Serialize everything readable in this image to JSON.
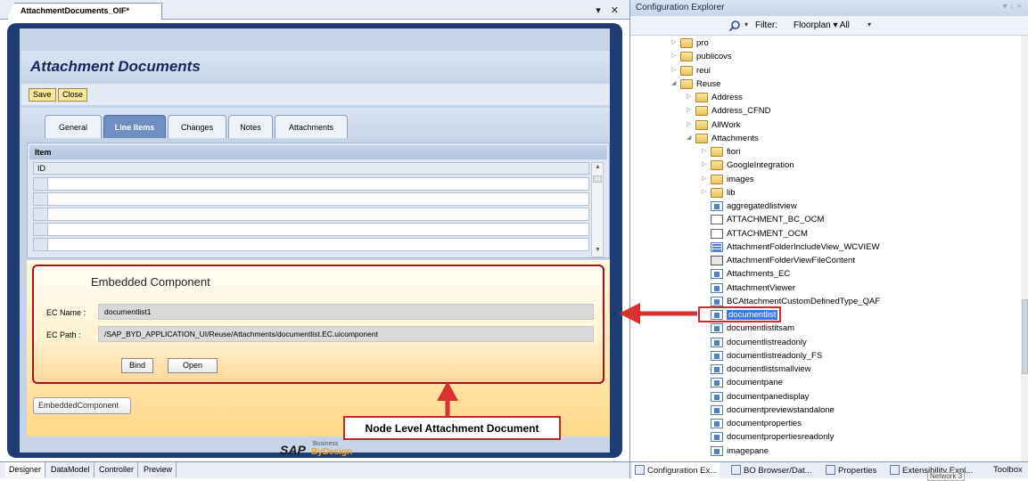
{
  "document_tab": {
    "title": "AttachmentDocuments_OIF*",
    "controls": "▾ ✕"
  },
  "page": {
    "title": "Attachment Documents"
  },
  "toolbar": {
    "save_label": "Save",
    "close_label": "Close"
  },
  "tabs": [
    {
      "label": "General"
    },
    {
      "label": "Line Items"
    },
    {
      "label": "Changes"
    },
    {
      "label": "Notes"
    },
    {
      "label": "Attachments"
    }
  ],
  "items_panel": {
    "title": "Item",
    "column": "ID"
  },
  "embedded_component": {
    "title": "Embedded Component",
    "name_label": "EC Name :",
    "name_value": "documentlist1",
    "path_label": "EC Path :",
    "path_value": "/SAP_BYD_APPLICATION_UI/Reuse/Attachments/documentlist.EC.uicomponent",
    "bind_label": "Bind",
    "open_label": "Open"
  },
  "embedded_component_button": "EmbeddedComponent",
  "callout": "Node Level Attachment Document",
  "logo": {
    "main": "SAP",
    "small": "Business",
    "product": "ByDesign"
  },
  "designer_tabs": [
    {
      "label": "Designer"
    },
    {
      "label": "DataModel"
    },
    {
      "label": "Controller"
    },
    {
      "label": "Preview"
    }
  ],
  "explorer": {
    "title": "Configuration Explorer",
    "title_controls": "▾ ↓ ×",
    "filter_label": "Filter:",
    "filter_value": "Floorplan  ▾ All",
    "tree": [
      {
        "label": "pro"
      },
      {
        "label": "publicovs"
      },
      {
        "label": "reui"
      },
      {
        "label": "Reuse"
      },
      {
        "label": "Address"
      },
      {
        "label": "Address_CFND"
      },
      {
        "label": "AllWork"
      },
      {
        "label": "Attachments"
      },
      {
        "label": "fiori"
      },
      {
        "label": "GoogleIntegration"
      },
      {
        "label": "images"
      },
      {
        "label": "lib"
      },
      {
        "label": "aggregatedlistview"
      },
      {
        "label": "ATTACHMENT_BC_OCM"
      },
      {
        "label": "ATTACHMENT_OCM"
      },
      {
        "label": "AttachmentFolderIncludeView_WCVIEW"
      },
      {
        "label": "AttachmentFolderViewFileContent"
      },
      {
        "label": "Attachments_EC"
      },
      {
        "label": "AttachmentViewer"
      },
      {
        "label": "BCAttachmentCustomDefinedType_QAF"
      },
      {
        "label": "documentlist"
      },
      {
        "label": "documentlistitsam"
      },
      {
        "label": "documentlistreadonly"
      },
      {
        "label": "documentlistreadonly_FS"
      },
      {
        "label": "documentlistsmallview"
      },
      {
        "label": "documentpane"
      },
      {
        "label": "documentpanedisplay"
      },
      {
        "label": "documentpreviewstandalone"
      },
      {
        "label": "documentproperties"
      },
      {
        "label": "documentpropertiesreadonly"
      },
      {
        "label": "imagepane"
      }
    ],
    "bottom_tabs": [
      {
        "label": "Configuration Ex..."
      },
      {
        "label": "BO Browser/Dat..."
      },
      {
        "label": "Properties"
      },
      {
        "label": "Extensibility Expl..."
      },
      {
        "label": "Toolbox"
      }
    ],
    "network_tooltip": "Network 3"
  }
}
